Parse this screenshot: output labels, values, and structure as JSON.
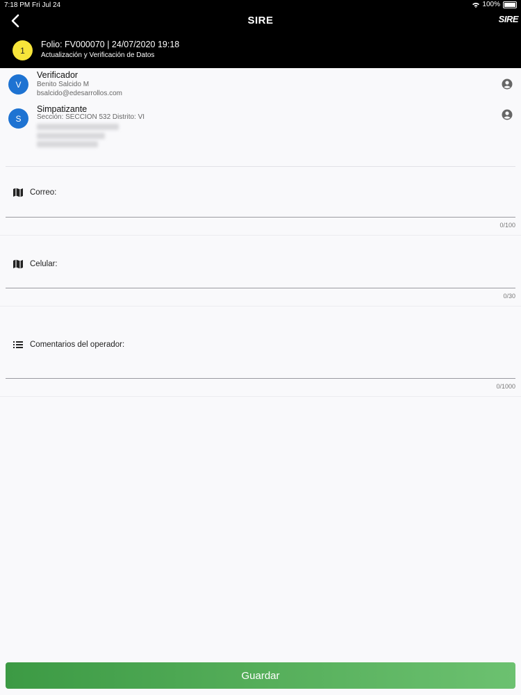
{
  "status_bar": {
    "time": "7:18 PM",
    "date": "Fri Jul 24",
    "battery": "100%"
  },
  "header": {
    "title": "SIRE",
    "logo_text": "SIRE"
  },
  "folio": {
    "step": "1",
    "title": "Folio: FV000070 | 24/07/2020 19:18",
    "subtitle": "Actualización y Verificación de Datos"
  },
  "verificador": {
    "initial": "V",
    "role": "Verificador",
    "name": "Benito Salcido M",
    "email": "bsalcido@edesarrollos.com"
  },
  "simpatizante": {
    "initial": "S",
    "role": "Simpatizante",
    "detail": "Sección: SECCION 532 Distrito: VI"
  },
  "fields": {
    "correo": {
      "label": "Correo:",
      "value": "",
      "counter": "0/100"
    },
    "celular": {
      "label": "Celular:",
      "value": "",
      "counter": "0/30"
    },
    "comentarios": {
      "label": "Comentarios del operador:",
      "value": "",
      "counter": "0/1000"
    }
  },
  "actions": {
    "save_label": "Guardar"
  },
  "colors": {
    "accent_green": "#55ae5a",
    "avatar_blue": "#1e73d2",
    "badge_yellow": "#f7e53a"
  }
}
